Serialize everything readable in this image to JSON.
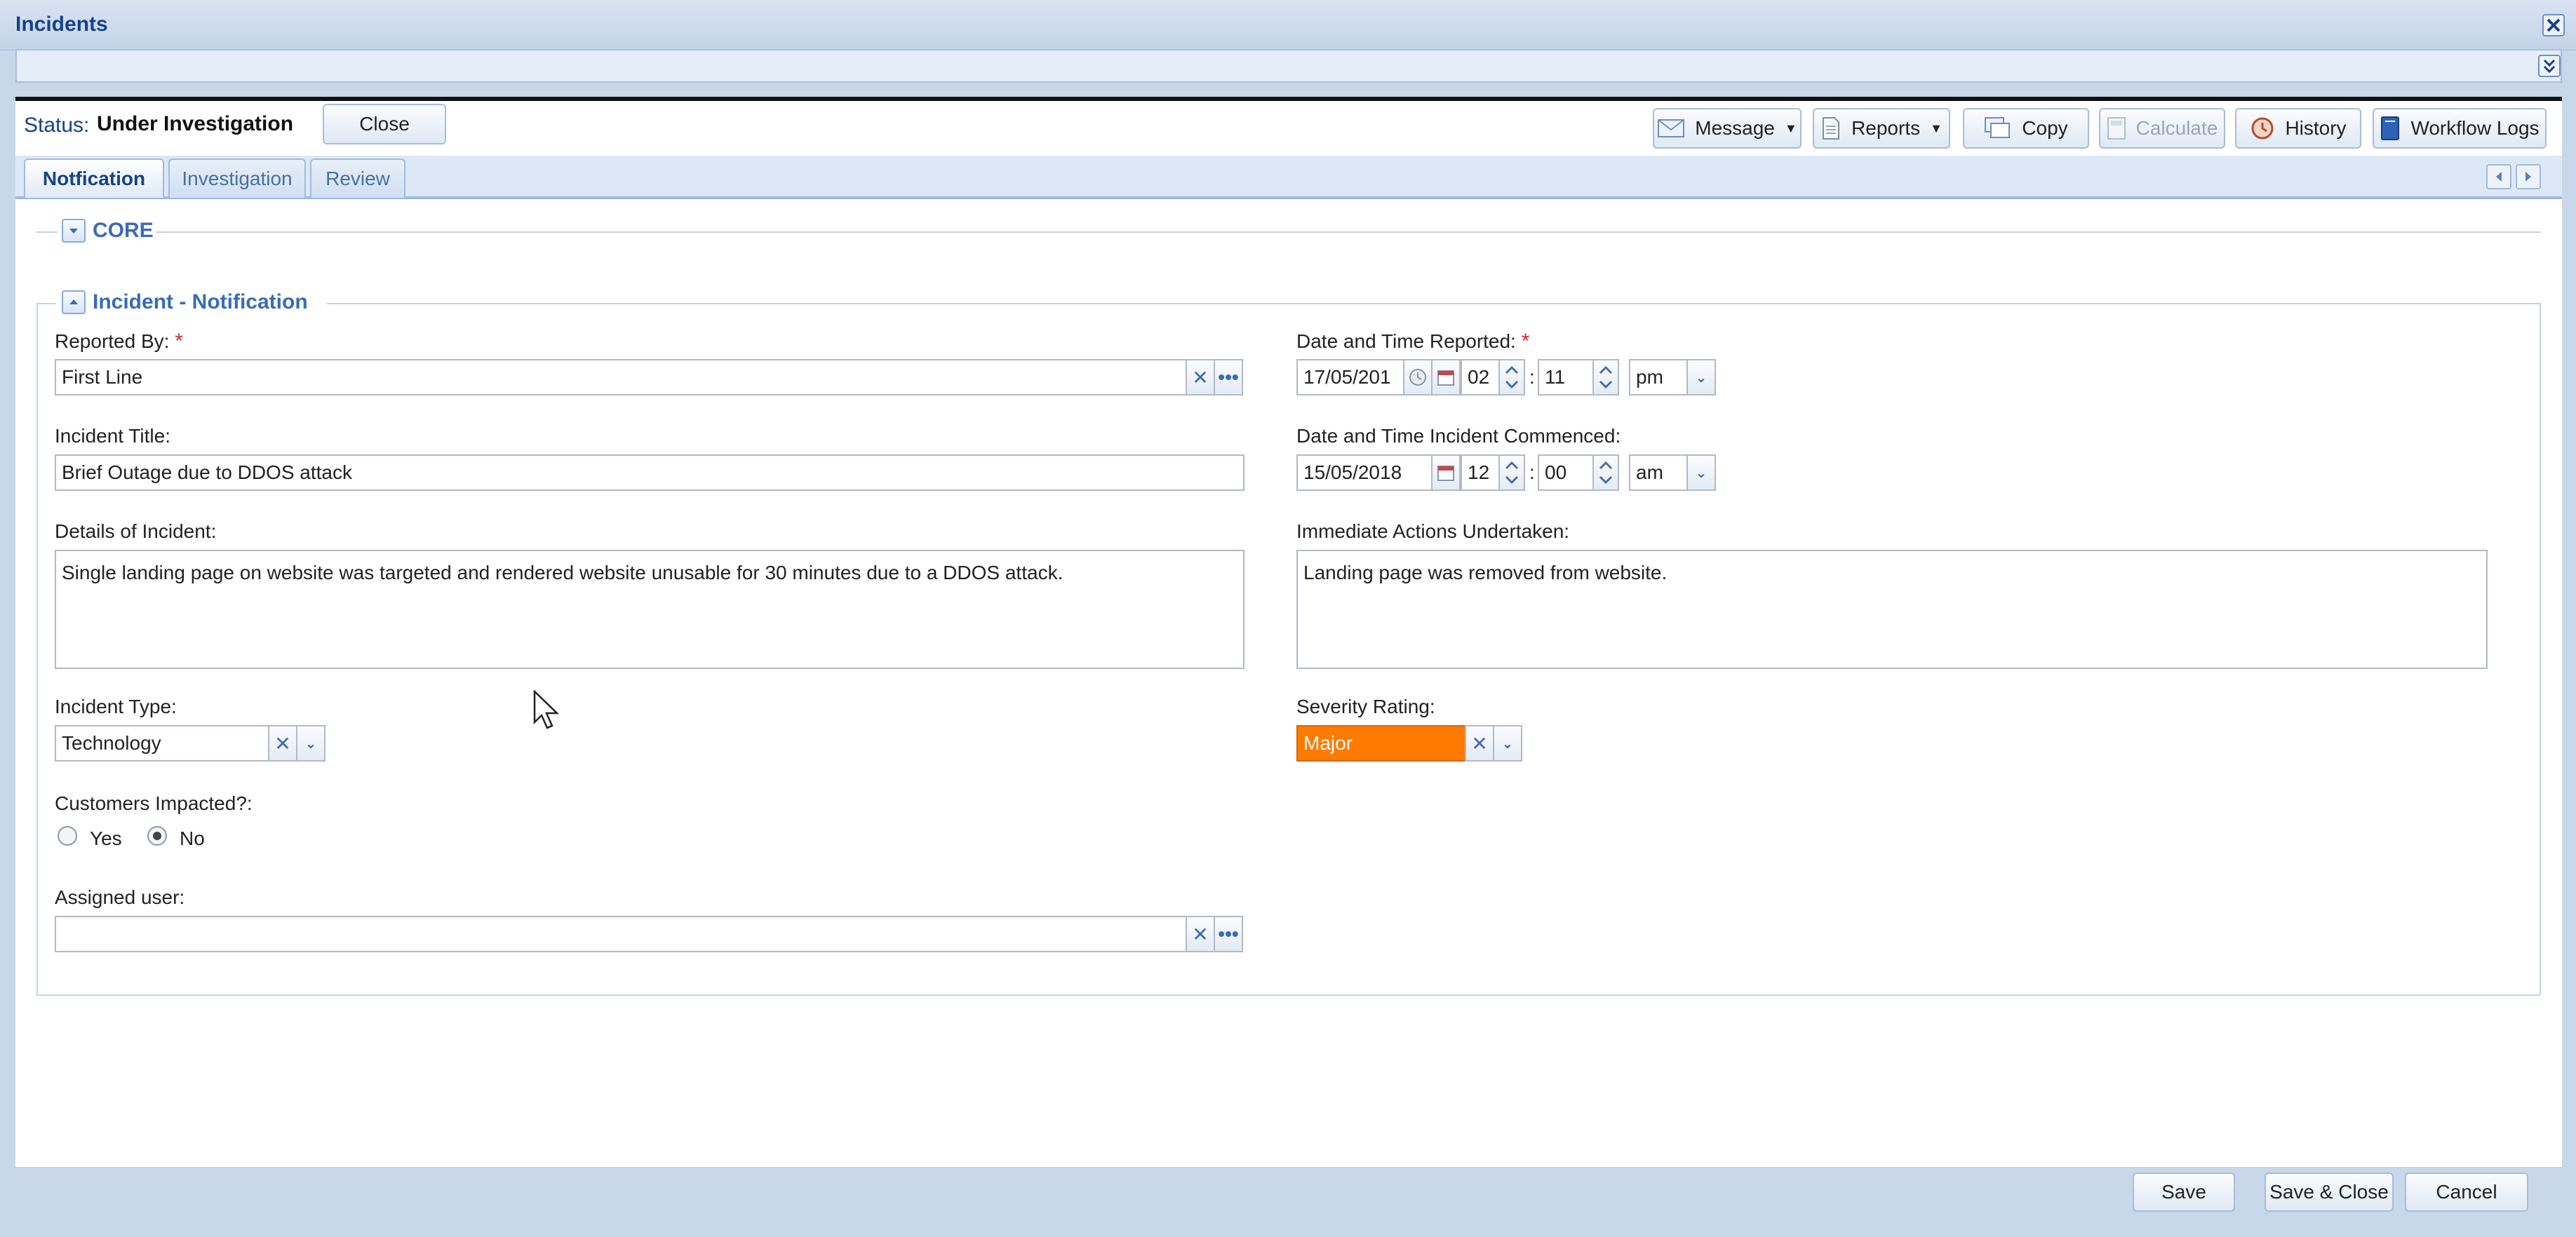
{
  "window": {
    "title": "Incidents"
  },
  "status": {
    "label": "Status:",
    "value": "Under Investigation",
    "close_label": "Close"
  },
  "toolbar": {
    "message": "Message",
    "reports": "Reports",
    "copy": "Copy",
    "calculate": "Calculate",
    "history": "History",
    "workflow_logs": "Workflow Logs"
  },
  "tabs": [
    {
      "label": "Notfication",
      "active": true
    },
    {
      "label": "Investigation",
      "active": false
    },
    {
      "label": "Review",
      "active": false
    }
  ],
  "sections": {
    "core": "CORE",
    "notification": "Incident - Notification"
  },
  "form": {
    "reported_by": {
      "label": "Reported By:",
      "value": "First Line",
      "required": "*"
    },
    "incident_title": {
      "label": "Incident Title:",
      "value": "Brief Outage due to DDOS attack"
    },
    "details": {
      "label": "Details of Incident:",
      "value": "Single landing page on website was targeted and rendered website unusable for 30 minutes due to a DDOS attack."
    },
    "incident_type": {
      "label": "Incident Type:",
      "value": "Technology"
    },
    "customers_impacted": {
      "label": "Customers Impacted?:",
      "yes": "Yes",
      "no": "No",
      "selected": "No"
    },
    "assigned_user": {
      "label": "Assigned user:",
      "value": ""
    },
    "date_reported": {
      "label": "Date and Time Reported:",
      "required": "*",
      "date": "17/05/201",
      "hour": "02",
      "minute": "11",
      "ampm": "pm"
    },
    "date_commenced": {
      "label": "Date and Time Incident Commenced:",
      "date": "15/05/2018",
      "hour": "12",
      "minute": "00",
      "ampm": "am"
    },
    "immediate_actions": {
      "label": "Immediate Actions Undertaken:",
      "value": "Landing page was removed from website."
    },
    "severity": {
      "label": "Severity Rating:",
      "value": "Major",
      "color": "#ff7a00"
    }
  },
  "bottom_buttons": {
    "save": "Save",
    "save_close": "Save & Close",
    "cancel": "Cancel"
  },
  "time_sep": ":",
  "colors": {
    "accent": "#15428b",
    "legend": "#3a6bb8",
    "severity": "#ff7a00"
  }
}
